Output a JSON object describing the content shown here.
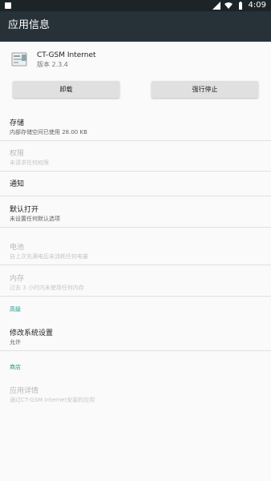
{
  "status_bar": {
    "time": "4:09",
    "icons": [
      "notification-icon",
      "signal-icon",
      "wifi-icon",
      "battery-icon"
    ]
  },
  "app_bar": {
    "title": "应用信息"
  },
  "app": {
    "name": "CT-GSM Internet",
    "version": "版本 2.3.4"
  },
  "buttons": {
    "uninstall": "卸载",
    "force_stop": "强行停止"
  },
  "settings": {
    "storage": {
      "title": "存储",
      "subtitle": "内部存储空间已使用 28.00 KB"
    },
    "permissions": {
      "title": "权限",
      "subtitle": "未请求任何权限"
    },
    "notifications": {
      "title": "通知"
    },
    "open_by_default": {
      "title": "默认打开",
      "subtitle": "未设置任何默认选项"
    },
    "battery": {
      "title": "电池",
      "subtitle": "自上次充满电后未消耗任何电量"
    },
    "memory": {
      "title": "内存",
      "subtitle": "过去 3 小时内未使用任何内存"
    },
    "advanced_header": "高级",
    "modify_system_settings": {
      "title": "修改系统设置",
      "subtitle": "允许"
    },
    "store_header": "商店",
    "app_details": {
      "title": "应用详情",
      "subtitle": "通过CT-GSM Internet安装的应用"
    }
  },
  "colors": {
    "status_bar": "#1d2427",
    "app_bar": "#263238",
    "accent": "#1a9a8a",
    "button_bg": "#e0e0e0"
  }
}
